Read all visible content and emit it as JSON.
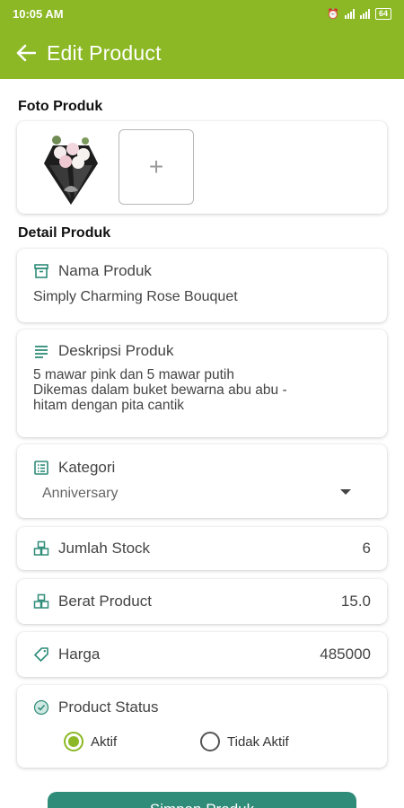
{
  "status_bar": {
    "time": "10:05 AM",
    "battery": "64"
  },
  "app_bar": {
    "title": "Edit Product"
  },
  "photo_section": {
    "title": "Foto Produk",
    "add_label": "+"
  },
  "detail_section": {
    "title": "Detail Produk"
  },
  "fields": {
    "nama": {
      "label": "Nama Produk",
      "value": "Simply Charming Rose Bouquet"
    },
    "deskripsi": {
      "label": "Deskripsi Produk",
      "value": "5 mawar pink dan 5 mawar putih\nDikemas dalam buket bewarna abu abu -\nhitam dengan pita cantik"
    },
    "kategori": {
      "label": "Kategori",
      "value": "Anniversary"
    },
    "stock": {
      "label": "Jumlah Stock",
      "value": "6"
    },
    "berat": {
      "label": "Berat Product",
      "value": "15.0"
    },
    "harga": {
      "label": "Harga",
      "value": "485000"
    },
    "status": {
      "label": "Product Status",
      "options": [
        {
          "label": "Aktif",
          "selected": true
        },
        {
          "label": "Tidak Aktif",
          "selected": false
        }
      ]
    }
  },
  "save_button": {
    "label": "Simpan Produk"
  },
  "colors": {
    "primary": "#8bb824",
    "button": "#2e8c79",
    "icon": "#2e8c79"
  }
}
